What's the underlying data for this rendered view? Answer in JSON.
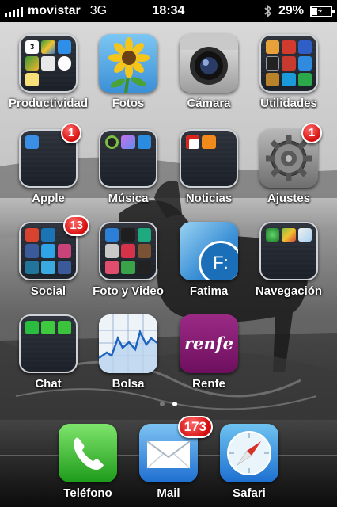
{
  "status": {
    "carrier": "movistar",
    "network": "3G",
    "time": "18:34",
    "battery": "29%",
    "battery_level": 0.29
  },
  "apps": {
    "productividad": {
      "label": "Productividad",
      "calendar_day": "3"
    },
    "fotos": {
      "label": "Fotos"
    },
    "camara": {
      "label": "Cámara"
    },
    "utilidades": {
      "label": "Utilidades"
    },
    "apple": {
      "label": "Apple",
      "badge": "1"
    },
    "musica": {
      "label": "Música"
    },
    "noticias": {
      "label": "Noticias"
    },
    "ajustes": {
      "label": "Ajustes",
      "badge": "1"
    },
    "social": {
      "label": "Social",
      "badge": "13"
    },
    "foto_video": {
      "label": "Foto y Video"
    },
    "fatima": {
      "label": "Fatima",
      "glyph": "F:"
    },
    "navegacion": {
      "label": "Navegación"
    },
    "chat": {
      "label": "Chat"
    },
    "bolsa": {
      "label": "Bolsa"
    },
    "renfe": {
      "label": "Renfe",
      "logo_text": "renfe"
    }
  },
  "dock": {
    "telefono": {
      "label": "Teléfono"
    },
    "mail": {
      "label": "Mail",
      "badge": "173"
    },
    "safari": {
      "label": "Safari"
    }
  },
  "colors": {
    "badge_red": "#d50f0f",
    "renfe_purple": "#7a1368",
    "fatima_blue": "#1b6fb8"
  },
  "pages": {
    "count": 2,
    "current": 2
  }
}
